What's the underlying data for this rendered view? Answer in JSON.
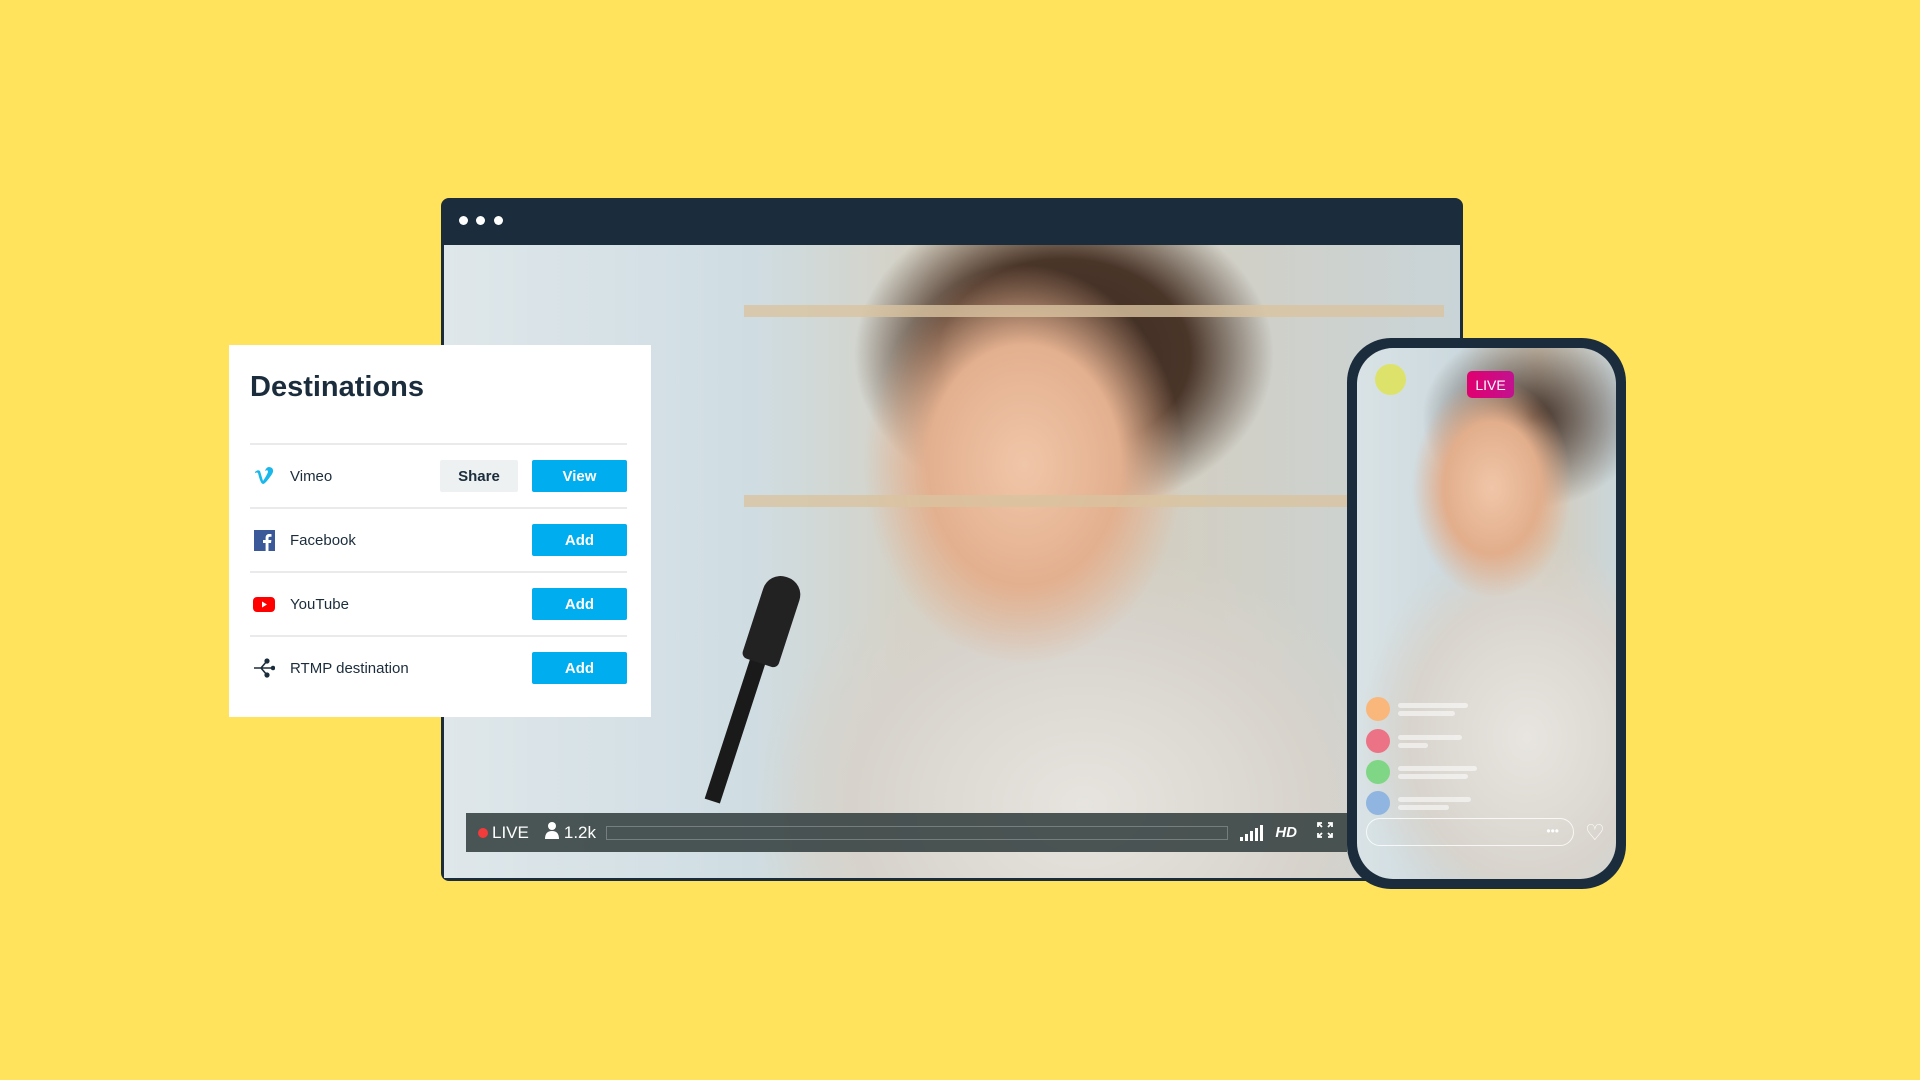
{
  "panel": {
    "title": "Destinations",
    "rows": [
      {
        "icon": "vimeo-icon",
        "label": "Vimeo",
        "secondary": "Share",
        "primary": "View"
      },
      {
        "icon": "facebook-icon",
        "label": "Facebook",
        "primary": "Add"
      },
      {
        "icon": "youtube-icon",
        "label": "YouTube",
        "primary": "Add"
      },
      {
        "icon": "rtmp-icon",
        "label": "RTMP destination",
        "primary": "Add"
      }
    ]
  },
  "player": {
    "live": "LIVE",
    "viewers": "1.2k",
    "quality": "HD"
  },
  "phone": {
    "live": "LIVE",
    "more": "•••"
  },
  "colors": {
    "background": "#ffe35c",
    "accent": "#00adef",
    "frame": "#1b2d3c",
    "live_dot": "#f23b3b",
    "phone_live": "#e0006f"
  }
}
